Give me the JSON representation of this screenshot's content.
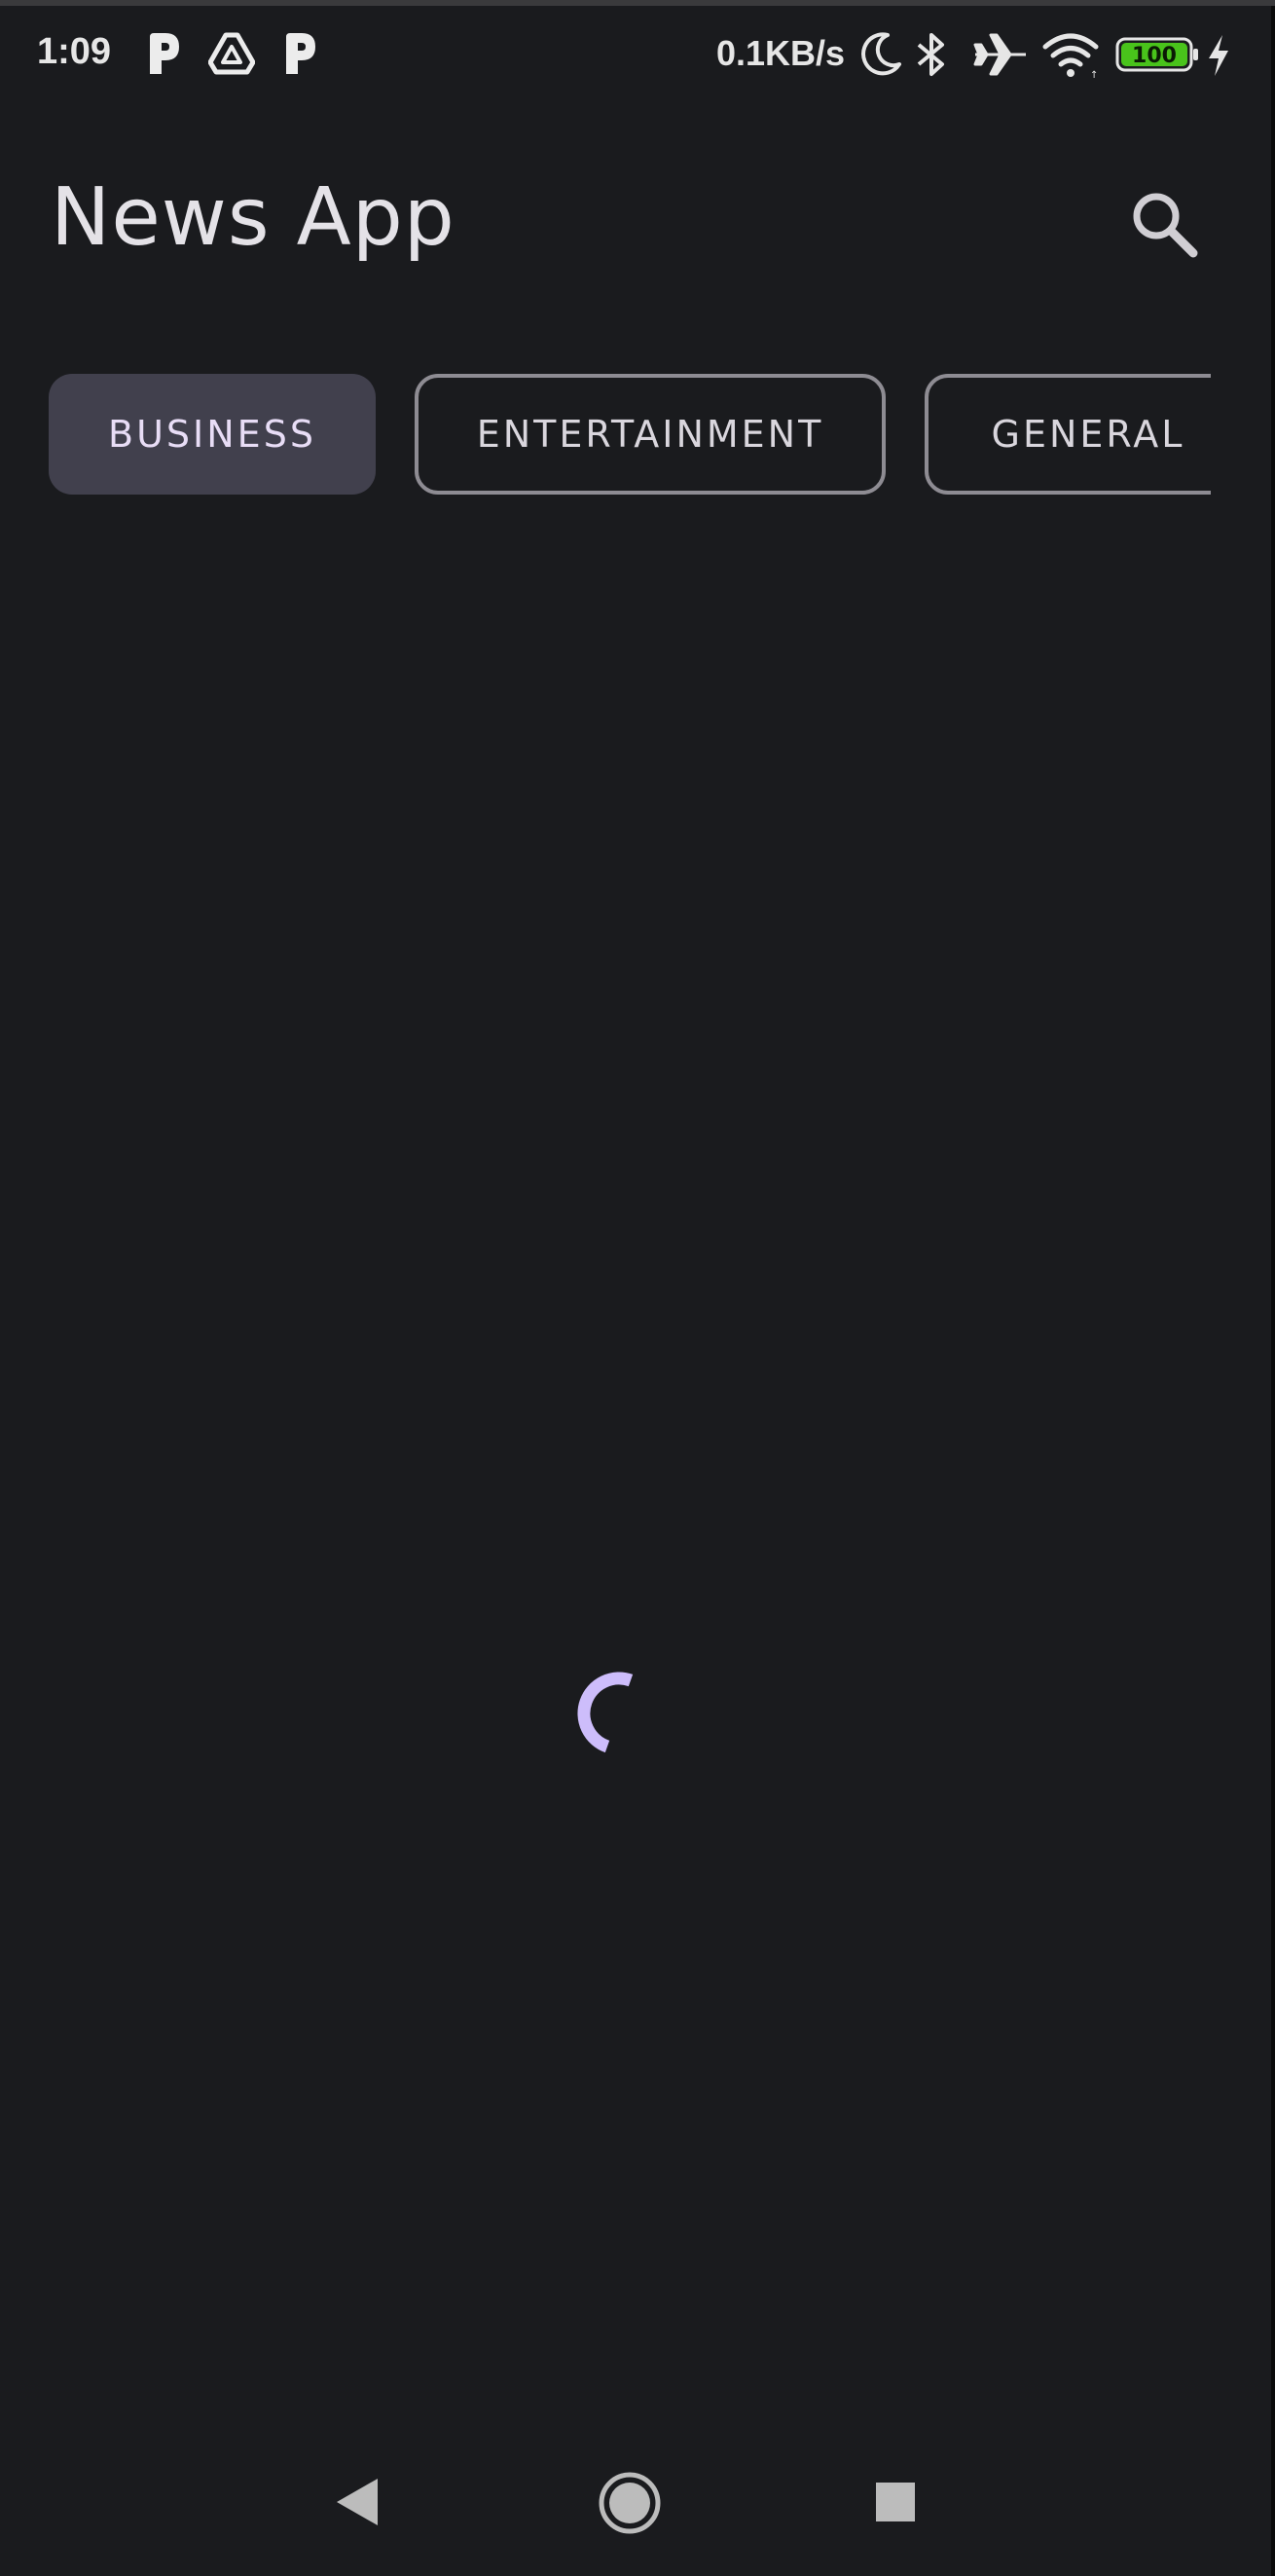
{
  "status_bar": {
    "time": "1:09",
    "notification_icons": [
      "p-app-icon",
      "drive-icon",
      "p-app-icon"
    ],
    "net_speed": "0.1KB/s",
    "battery_level": "100",
    "icons": [
      "moon-icon",
      "bluetooth-icon",
      "airplane-icon",
      "wifi-icon",
      "battery-icon",
      "charging-icon"
    ]
  },
  "app_bar": {
    "title": "News App",
    "search_icon": "search-icon"
  },
  "categories": [
    {
      "label": "BUSINESS",
      "selected": true
    },
    {
      "label": "ENTERTAINMENT",
      "selected": false
    },
    {
      "label": "GENERAL",
      "selected": false
    }
  ],
  "loading": {
    "indicator": "circular-progress",
    "color": "#cdbdfb"
  },
  "nav_bar": {
    "buttons": [
      "back-icon",
      "home-icon",
      "recents-icon"
    ]
  },
  "colors": {
    "background": "#1a1b1e",
    "chip_selected_bg": "#41404d",
    "accent": "#cdbdfb",
    "battery_green": "#49c31b"
  }
}
